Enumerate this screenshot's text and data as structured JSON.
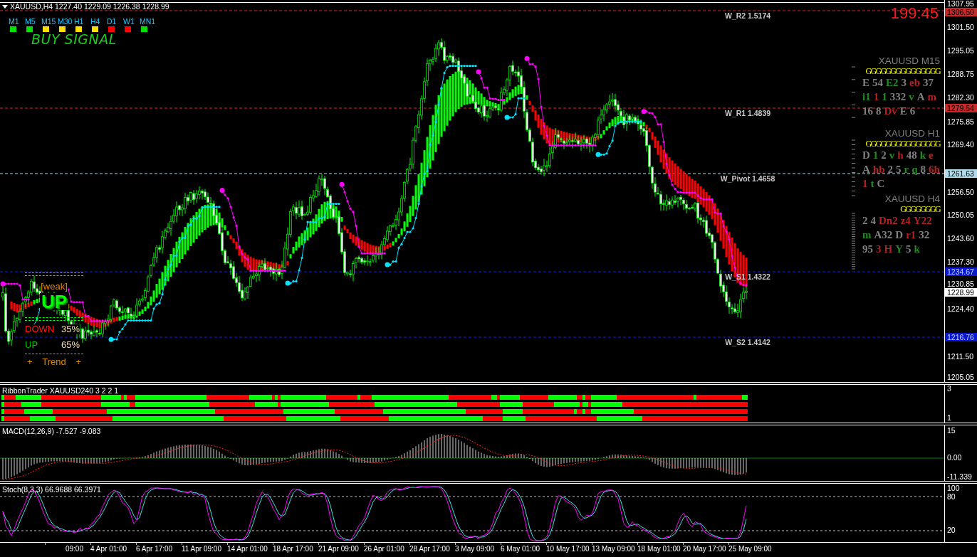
{
  "chart": {
    "symbol_line": "XAUUSD,H4 1227.40 1229.09 1226.38 1228.99",
    "timer": "199:45",
    "signal": "BUY SIGNAL"
  },
  "timeframes": [
    {
      "label": "M1",
      "color": "#00e000"
    },
    {
      "label": "M5",
      "color": "#00e000"
    },
    {
      "label": "M15",
      "color": "#ffe000"
    },
    {
      "label": "M30",
      "color": "#ffe000"
    },
    {
      "label": "H1",
      "color": "#ffe000"
    },
    {
      "label": "H4",
      "color": "#ffe000"
    },
    {
      "label": "D1",
      "color": "#ff0000"
    },
    {
      "label": "W1",
      "color": "#ff0000"
    },
    {
      "label": "MN1",
      "color": "#00e000"
    }
  ],
  "levels": [
    {
      "kind": "resistance",
      "axis_label": "1306.50",
      "caption": "W_R2 1.5174"
    },
    {
      "kind": "resistance",
      "axis_label": "1279.54",
      "caption": "W_R1 1.4839"
    },
    {
      "kind": "pivot",
      "axis_label": "1261.63",
      "caption": "W_Pivot 1.4658"
    },
    {
      "kind": "support",
      "axis_label": "1234.67",
      "caption": "W_S1 1.4322"
    },
    {
      "kind": "bid",
      "axis_label": "1228.99"
    },
    {
      "kind": "support",
      "axis_label": "1216.76",
      "caption": "W_S2 1.4142"
    }
  ],
  "price_axis": [
    "1307.95",
    "1301.50",
    "1295.05",
    "1288.75",
    "1282.30",
    "1275.85",
    "1269.40",
    "1256.50",
    "1250.05",
    "1243.60",
    "1237.30",
    "1230.85",
    "1224.40",
    "1211.50",
    "1205.05"
  ],
  "trend_panel": {
    "strength": "[weak]",
    "direction": "UP",
    "rows": [
      {
        "kind": "down",
        "label": "DOWN",
        "value": "35%"
      },
      {
        "kind": "up",
        "label": "UP",
        "value": "65%"
      }
    ],
    "footer": [
      "+",
      "Trend",
      "+"
    ]
  },
  "scanner": [
    {
      "title": "XAUUSD M15",
      "signals": "GGGGGGGGGGGGGGG",
      "marks": [
        {
          "text": "E",
          "color": "#808080"
        },
        {
          "text": "54",
          "color": "#808080"
        },
        {
          "text": "E2",
          "color": "#228b22"
        },
        {
          "text": "3",
          "color": "#808080"
        },
        {
          "text": "eb",
          "color": "#b22222"
        },
        {
          "text": "37",
          "color": "#808080"
        },
        {
          "text": "i1",
          "color": "#228b22"
        },
        {
          "text": "1",
          "color": "#b22222"
        },
        {
          "text": "1",
          "color": "#228b22"
        },
        {
          "text": "332",
          "color": "#808080"
        },
        {
          "text": "v",
          "color": "#228b22"
        },
        {
          "text": "A",
          "color": "#808080"
        },
        {
          "text": "m",
          "color": "#b22222"
        },
        {
          "text": "16",
          "color": "#808080"
        },
        {
          "text": "8",
          "color": "#808080"
        },
        {
          "text": "Dv",
          "color": "#b22222"
        },
        {
          "text": "E",
          "color": "#808080"
        },
        {
          "text": "6",
          "color": "#808080"
        }
      ]
    },
    {
      "title": "XAUUSD H1",
      "signals": "GGGGGGGGGGGGGGG",
      "marks": [
        {
          "text": "D",
          "color": "#808080"
        },
        {
          "text": "1",
          "color": "#228b22"
        },
        {
          "text": "2",
          "color": "#808080"
        },
        {
          "text": "v",
          "color": "#228b22"
        },
        {
          "text": "h",
          "color": "#b22222"
        },
        {
          "text": "48",
          "color": "#808080"
        },
        {
          "text": "k",
          "color": "#228b22"
        },
        {
          "text": "e",
          "color": "#b22222"
        },
        {
          "text": "A",
          "color": "#808080"
        },
        {
          "text": "hb",
          "color": "#b22222"
        },
        {
          "text": "2",
          "color": "#808080"
        },
        {
          "text": "5",
          "color": "#808080"
        },
        {
          "text": "r",
          "color": "#228b22"
        },
        {
          "text": "q",
          "color": "#228b22"
        },
        {
          "text": "8",
          "color": "#808080"
        },
        {
          "text": "6h",
          "color": "#b22222"
        },
        {
          "text": "1",
          "color": "#b22222"
        },
        {
          "text": "t",
          "color": "#228b22"
        },
        {
          "text": "C",
          "color": "#808080"
        }
      ]
    },
    {
      "title": "XAUUSD H4",
      "signals": "GGGGGGGG",
      "marks": [
        {
          "text": "2",
          "color": "#808080"
        },
        {
          "text": "4",
          "color": "#808080"
        },
        {
          "text": "Dn2",
          "color": "#b22222"
        },
        {
          "text": "z4",
          "color": "#b22222"
        },
        {
          "text": "Y22",
          "color": "#b22222"
        },
        {
          "text": "m",
          "color": "#228b22"
        },
        {
          "text": "A32",
          "color": "#808080"
        },
        {
          "text": "D",
          "color": "#808080"
        },
        {
          "text": "r1",
          "color": "#b22222"
        },
        {
          "text": "32",
          "color": "#808080"
        },
        {
          "text": "95",
          "color": "#808080"
        },
        {
          "text": "3",
          "color": "#b22222"
        },
        {
          "text": "H",
          "color": "#b22222"
        },
        {
          "text": "Y",
          "color": "#228b22"
        },
        {
          "text": "5",
          "color": "#808080"
        },
        {
          "text": "k",
          "color": "#228b22"
        }
      ]
    }
  ],
  "ribbon_panel": {
    "title": "RibbonTrader XAUUSD240 3 2 2 1",
    "scale": [
      "3",
      "1"
    ]
  },
  "macd_panel": {
    "title": "MACD(12,26,9) -7.527 -9.083",
    "scale": [
      "15",
      "0.00",
      "-11.339"
    ]
  },
  "stoch_panel": {
    "title": "Stoch(8,3,3) 66.9688 66.3971",
    "scale": [
      "100",
      "80",
      "20"
    ]
  },
  "time_axis": [
    "09:00",
    "4 Apr 01:00",
    "6 Apr 17:00",
    "11 Apr 09:00",
    "14 Apr 01:00",
    "18 Apr 17:00",
    "21 Apr 09:00",
    "26 Apr 01:00",
    "28 Apr 17:00",
    "3 May 09:00",
    "6 May 01:00",
    "10 May 17:00",
    "13 May 09:00",
    "18 May 01:00",
    "20 May 17:00",
    "25 May 09:00"
  ]
}
